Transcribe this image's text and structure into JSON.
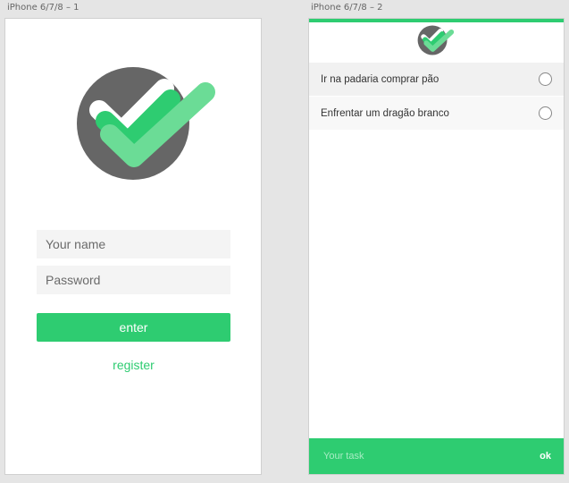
{
  "artboards": [
    {
      "label": "iPhone 6/7/8 – 1"
    },
    {
      "label": "iPhone 6/7/8 – 2"
    }
  ],
  "login": {
    "name_placeholder": "Your name",
    "password_placeholder": "Password",
    "enter_label": "enter",
    "register_label": "register"
  },
  "tasks": {
    "items": [
      {
        "label": "Ir na padaria comprar pão",
        "done": false
      },
      {
        "label": "Enfrentar um dragão branco",
        "done": false
      }
    ],
    "input_placeholder": "Your task",
    "ok_label": "ok"
  },
  "colors": {
    "accent": "#2ecc71",
    "accent_light": "#6bdc96",
    "logo_circle": "#666666"
  },
  "icons": {
    "logo": "checkmark-logo-icon",
    "checkbox": "radio-circle-icon"
  }
}
